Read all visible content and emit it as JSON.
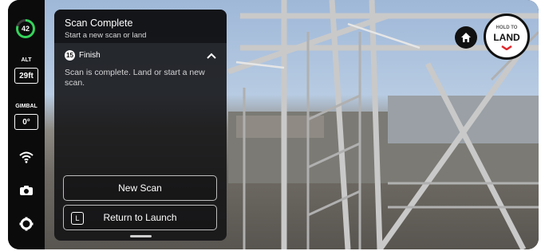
{
  "sidebar": {
    "battery_percent": "42",
    "battery_color": "#35d35a",
    "alt_label": "ALT",
    "alt_value": "29ft",
    "gimbal_label": "GIMBAL",
    "gimbal_value": "0°",
    "icons": [
      "wifi-icon",
      "camera-icon",
      "settings-icon"
    ]
  },
  "panel": {
    "title": "Scan Complete",
    "subtitle": "Start a new scan or land",
    "step_number": "15",
    "step_label": "Finish",
    "step_text": "Scan is complete. Land or start a new scan.",
    "new_scan_label": "New Scan",
    "rtl_icon_letter": "L",
    "rtl_label": "Return to Launch"
  },
  "controls": {
    "home_icon": "home-icon",
    "hold_to": "HOLD TO",
    "land": "LAND",
    "accent": "#e0262b"
  }
}
